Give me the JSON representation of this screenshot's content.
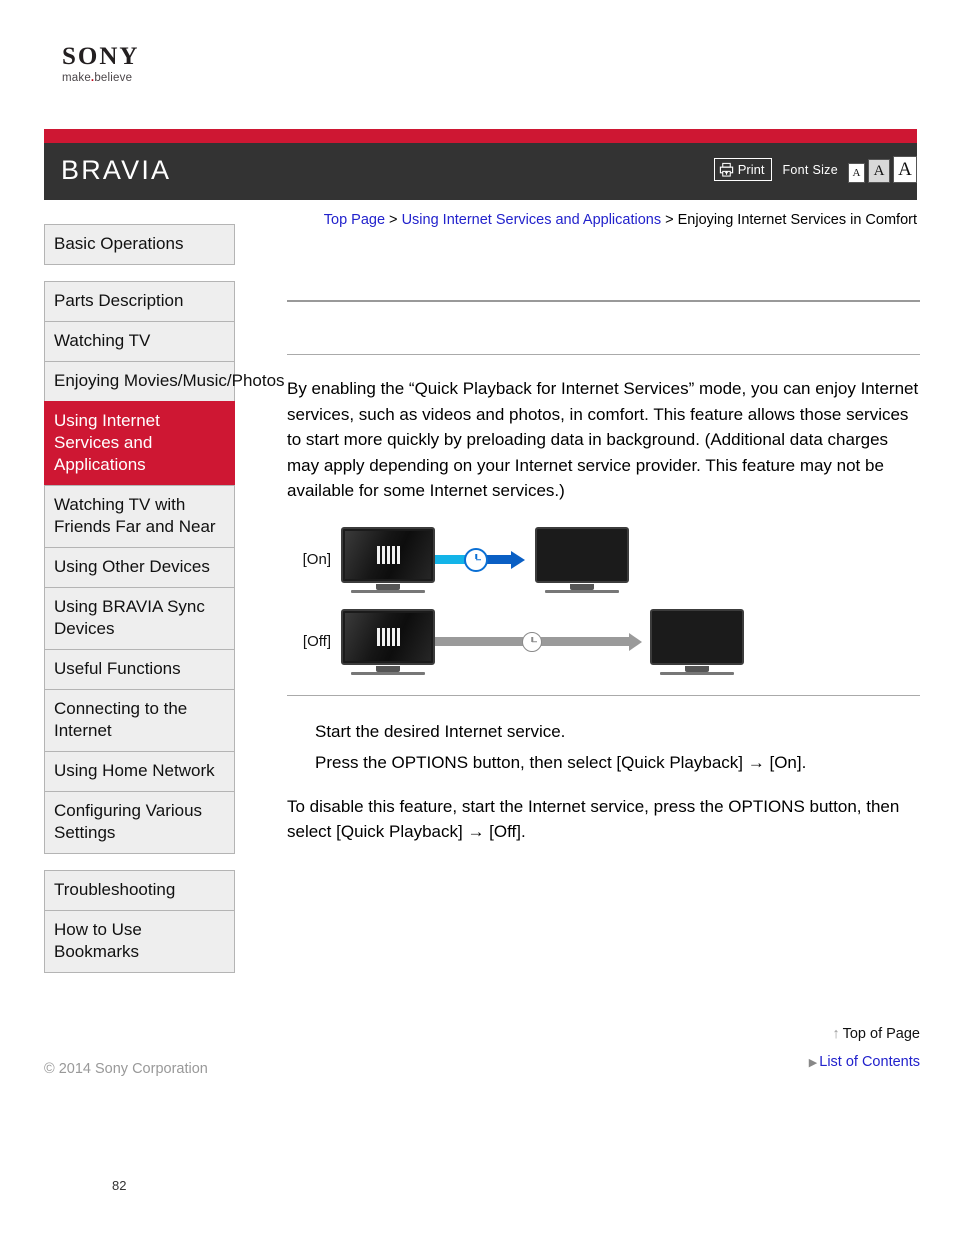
{
  "brand": {
    "wordmark": "SONY",
    "tagline_pre": "make",
    "tagline_dot": ".",
    "tagline_post": "believe"
  },
  "header": {
    "title": "BRAVIA",
    "print_label": "Print",
    "font_size_label": "Font Size",
    "font_size_options": [
      {
        "label": "A",
        "selected": false
      },
      {
        "label": "A",
        "selected": true
      },
      {
        "label": "A",
        "selected": false
      }
    ],
    "stripe_color": "#ce1733",
    "bar_color": "#333333"
  },
  "breadcrumb": {
    "item1": "Top Page",
    "sep1": " > ",
    "item2": "Using Internet Services and Applications",
    "sep2": " > ",
    "item3": "Enjoying Internet Services in Comfort"
  },
  "sidebar": {
    "groups": [
      {
        "items": [
          {
            "label": "Basic Operations",
            "active": false
          }
        ]
      },
      {
        "items": [
          {
            "label": "Parts Description",
            "active": false
          },
          {
            "label": "Watching TV",
            "active": false
          },
          {
            "label": "Enjoying Movies/Music/Photos",
            "active": false
          },
          {
            "label": "Using Internet Services and Applications",
            "active": true
          },
          {
            "label": "Watching TV with Friends Far and Near",
            "active": false
          },
          {
            "label": "Using Other Devices",
            "active": false
          },
          {
            "label": "Using BRAVIA Sync Devices",
            "active": false
          },
          {
            "label": "Useful Functions",
            "active": false
          },
          {
            "label": "Connecting to the Internet",
            "active": false
          },
          {
            "label": "Using Home Network",
            "active": false
          },
          {
            "label": "Configuring Various Settings",
            "active": false
          }
        ]
      },
      {
        "items": [
          {
            "label": "Troubleshooting",
            "active": false
          },
          {
            "label": "How to Use Bookmarks",
            "active": false
          }
        ]
      }
    ]
  },
  "main": {
    "body_paragraph": "By enabling the “Quick Playback for Internet Services” mode, you can enjoy Internet services, such as videos and photos, in comfort. This feature allows those services to start more quickly by preloading data in background. (Additional data charges may apply depending on your Internet service provider. This feature may not be available for some Internet services.)",
    "diagram": {
      "on_label": "[On]",
      "off_label": "[Off]",
      "on_arrow_color": "#0a5fc4",
      "off_arrow_color": "#9a9a9a"
    },
    "steps": [
      "Start the desired Internet service.",
      "Press the OPTIONS button, then select [Quick Playback] → [On]."
    ],
    "closing_paragraph": "To disable this feature, start the Internet service, press the OPTIONS button, then select [Quick Playback] → [Off]."
  },
  "footer": {
    "top_of_page_arrow": "↑",
    "top_of_page": "Top of Page",
    "list_triangle": "▶",
    "list_of_contents": "List of Contents",
    "copyright": "© 2014 Sony Corporation",
    "page_number": "82"
  }
}
